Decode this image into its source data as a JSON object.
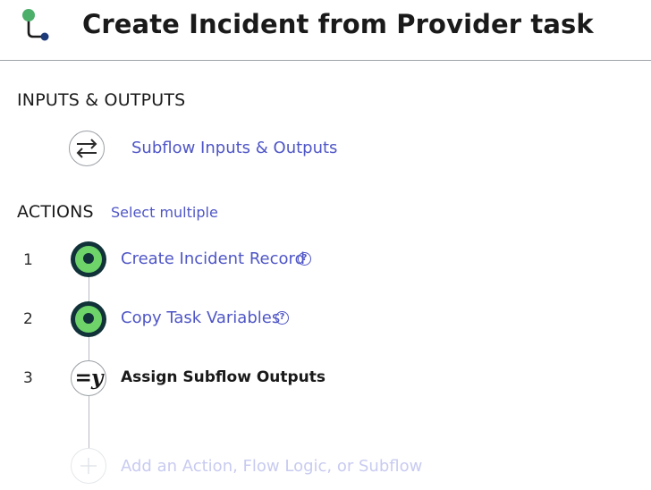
{
  "header": {
    "title": "Create Incident from Provider task",
    "icon": "subflow-icon",
    "colors": {
      "node_top": "#4caf6a",
      "node_bottom": "#1c3a7a",
      "stem": "#1a1a1a"
    }
  },
  "inputs_outputs": {
    "section_title": "INPUTS & OUTPUTS",
    "icon": "swap-arrows-icon",
    "link_label": "Subflow Inputs & Outputs"
  },
  "actions": {
    "section_title": "ACTIONS",
    "select_multiple_label": "Select multiple",
    "steps": [
      {
        "number": "1",
        "label": "Create Incident Record",
        "icon": "action-ring-icon",
        "help": true,
        "help_glyph": "?"
      },
      {
        "number": "2",
        "label": "Copy Task Variables",
        "icon": "action-ring-icon",
        "help": true,
        "help_glyph": "?"
      },
      {
        "number": "3",
        "label": "Assign Subflow Outputs",
        "icon": "assign-variable-icon",
        "glyph": "=y",
        "help": false
      }
    ],
    "add_label": "Add an Action, Flow Logic, or Subflow"
  },
  "colors": {
    "link": "#4f56c6",
    "action_icon_dark": "#103238",
    "action_icon_green": "#6ed46a",
    "disabled_link": "#c8cbf0",
    "divider": "#9ea3a8"
  }
}
